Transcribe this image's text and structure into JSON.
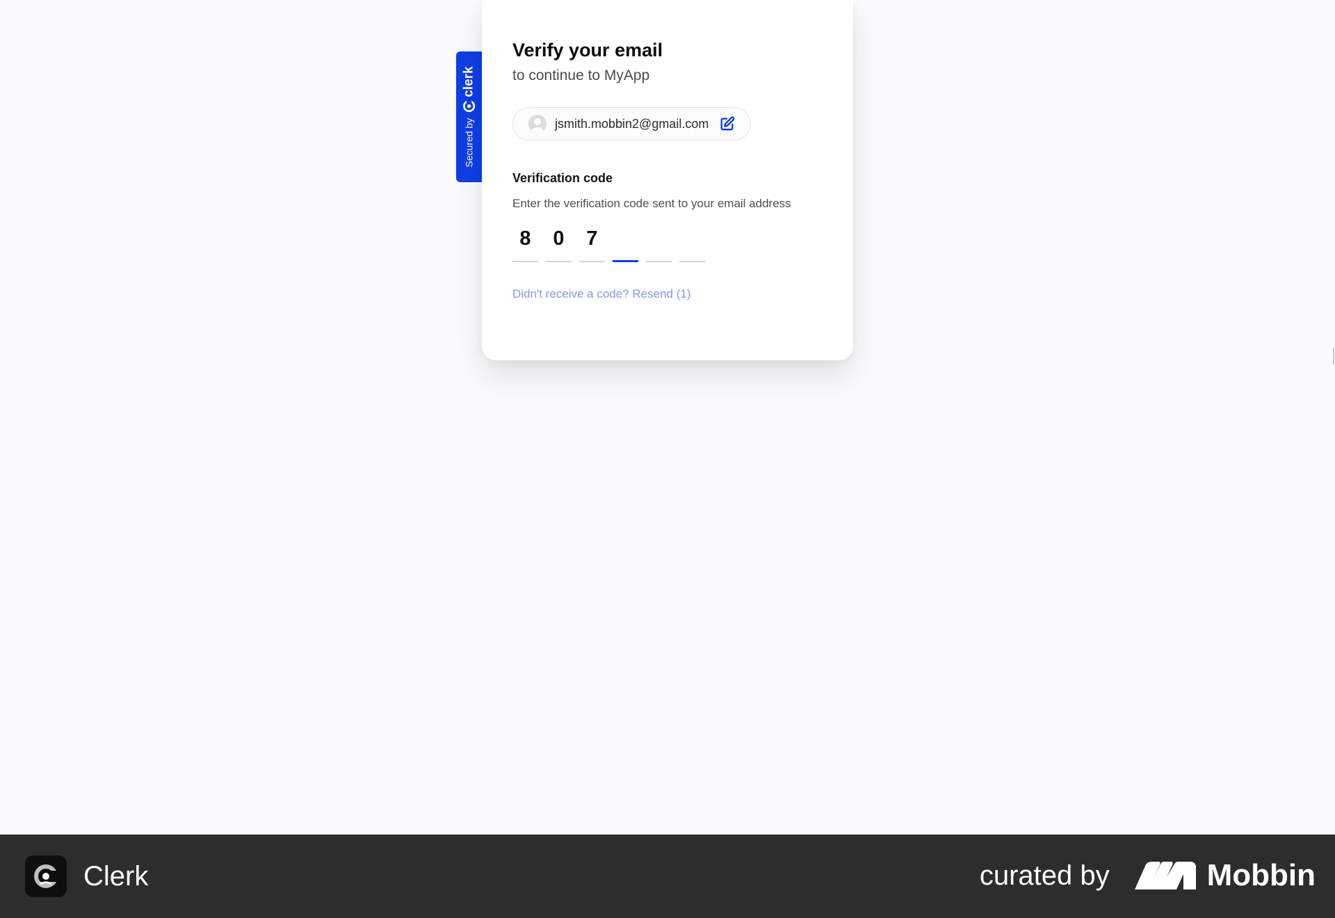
{
  "badge": {
    "secured_by": "Secured by",
    "brand": "clerk"
  },
  "card": {
    "title": "Verify your email",
    "subtitle": "to continue to MyApp",
    "identity": {
      "email": "jsmith.mobbin2@gmail.com"
    },
    "verification": {
      "label": "Verification code",
      "hint": "Enter the verification code sent to your email address",
      "digits": [
        "8",
        "0",
        "7",
        "",
        "",
        ""
      ],
      "active_index": 3
    },
    "resend_label": "Didn't receive a code? Resend (1)"
  },
  "footer": {
    "app_name": "Clerk",
    "curated_by": "curated by",
    "curator": "Mobbin"
  },
  "colors": {
    "accent": "#103ee6",
    "resend_link": "#8599e6",
    "footer_bg": "#2d2d2d",
    "page_bg": "#f9fafb"
  },
  "icons": {
    "avatar": "user-avatar-icon",
    "edit": "edit-pencil-icon",
    "clerk": "clerk-logo-icon",
    "mobbin": "mobbin-logo-icon"
  }
}
